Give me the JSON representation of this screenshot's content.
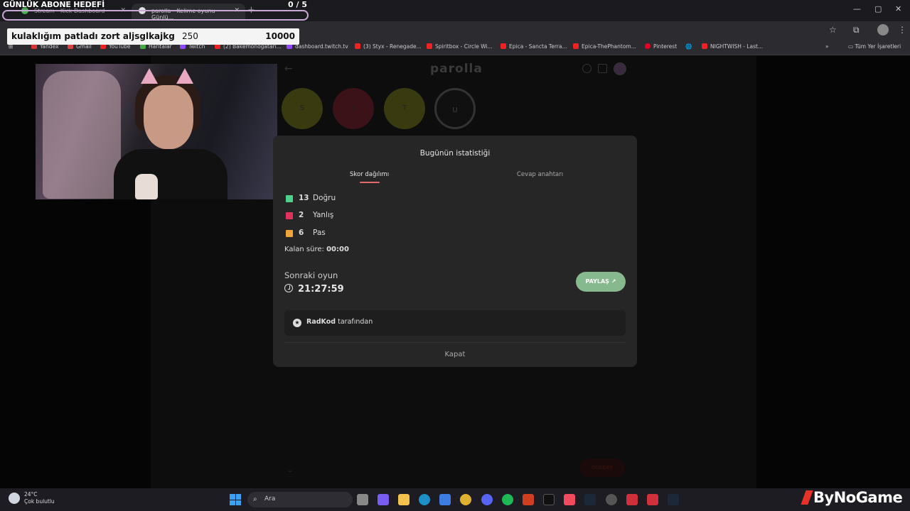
{
  "overlay": {
    "goal_title": "GÜNLÜK ABONE HEDEFİ",
    "goal_count": "0  / 5",
    "donation_message": "kulaklığım patladı zort aljsglkajkg",
    "donation_amount": "250",
    "donation_target": "10000"
  },
  "browser": {
    "tabs": [
      {
        "label": "Stream - Kick Dashboard"
      },
      {
        "label": "parolla - Kelime oyunu Günlü..."
      }
    ],
    "bookmarks": [
      {
        "label": "Yandex",
        "color": "#d33"
      },
      {
        "label": "Gmail",
        "color": "#d44"
      },
      {
        "label": "YouTube",
        "color": "#e22"
      },
      {
        "label": "Haritalar",
        "color": "#4a4"
      },
      {
        "label": "Twitch",
        "color": "#9147ff"
      },
      {
        "label": "(2) Bakemonogatari...",
        "color": "#e22"
      },
      {
        "label": "dashboard.twitch.tv",
        "color": "#9147ff"
      },
      {
        "label": "(3) Styx - Renegade...",
        "color": "#e22"
      },
      {
        "label": "Spiritbox - Circle Wi...",
        "color": "#e22"
      },
      {
        "label": "Epica - Sancta Terra...",
        "color": "#e22"
      },
      {
        "label": "Epica-ThePhantom...",
        "color": "#e22"
      },
      {
        "label": "Pinterest",
        "color": "#e60023"
      },
      {
        "label": "NIGHTWISH - Last...",
        "color": "#e22"
      }
    ],
    "all_bookmarks": "Tüm Yer İşaretleri"
  },
  "game": {
    "logo": "parolla",
    "letters": [
      "S",
      "Ş",
      "T",
      "U"
    ]
  },
  "modal": {
    "title": "Bugünün istatistiği",
    "tab_score": "Skor dağılımı",
    "tab_answers": "Cevap anahtarı",
    "stats": [
      {
        "count": "13",
        "label": "Doğru",
        "color": "#4ed18b"
      },
      {
        "count": "2",
        "label": "Yanlış",
        "color": "#e0325a"
      },
      {
        "count": "6",
        "label": "Pas",
        "color": "#f2a53a"
      }
    ],
    "remaining_label": "Kalan süre:",
    "remaining_value": "00:00",
    "next_game_label": "Sonraki oyun",
    "next_game_time": "21:27:59",
    "share_label": "PAYLAŞ",
    "credit_brand": "RadKod",
    "credit_suffix": "tarafından",
    "close_label": "Kapat"
  },
  "page_bottom": {
    "submit_label": "GÖNDER"
  },
  "taskbar": {
    "temperature": "24°C",
    "weather": "Çok bulutlu",
    "search_placeholder": "Ara",
    "watermark": "ByNoGame"
  }
}
